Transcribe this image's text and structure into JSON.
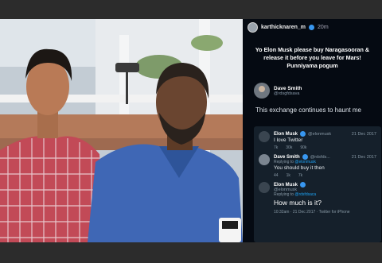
{
  "story": {
    "username": "karthicknaren_m",
    "time": "20m",
    "caption": "Yo Elon Musk please buy Naragasooran & release it before you leave for Mars! Punniyama pogum",
    "quoted_name": "Dave Smith",
    "quoted_handle": "@rdsgfdsava",
    "haunt_text": "This exchange continues to haunt me"
  },
  "tweets": [
    {
      "name": "Elon Musk",
      "handle": "@elonmusk",
      "date": "21 Dec 2017",
      "reply_prefix": "",
      "reply_to": "",
      "text": "I love Twitter",
      "stats": [
        "7k",
        "30k",
        "90k"
      ]
    },
    {
      "name": "Dave Smith",
      "handle": "@rdsfds...",
      "date": "21 Dec 2017",
      "reply_prefix": "Replying to",
      "reply_to": "@elonmusk",
      "text": "You should buy it then",
      "stats": [
        "44",
        "1k",
        "7k"
      ]
    },
    {
      "name": "Elon Musk",
      "handle": "@elonmusk",
      "date": "",
      "reply_prefix": "Replying to",
      "reply_to": "@rdsfdsaca",
      "text": "How much is it?",
      "footer": "10:32am · 21 Dec 2017 · Twitter for iPhone"
    }
  ],
  "colors": {
    "verified": "#3897f0",
    "twitter_card": "#15202b",
    "link": "#1da1f2"
  }
}
